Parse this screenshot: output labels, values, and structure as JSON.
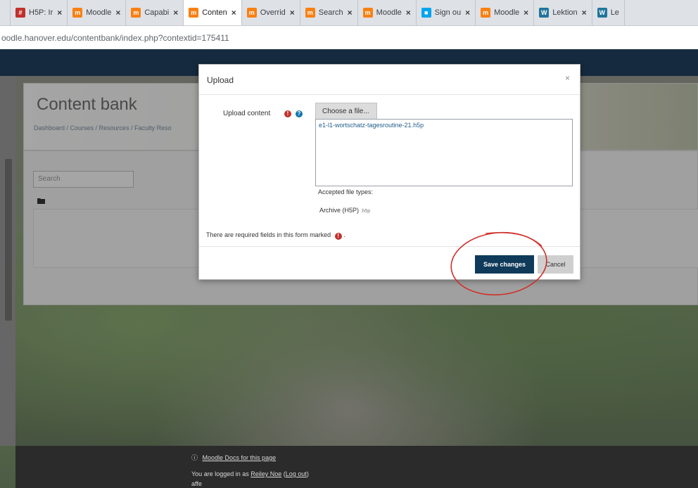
{
  "tabs": [
    {
      "label": "H5P: Ir",
      "icon": "h5p-icon",
      "color": "#c0312b",
      "active": false
    },
    {
      "label": "Moodle",
      "icon": "moodle-icon",
      "color": "#f98012",
      "active": false
    },
    {
      "label": "Capabi",
      "icon": "moodle-m-icon",
      "color": "#f98012",
      "active": false
    },
    {
      "label": "Conten",
      "icon": "moodle-icon",
      "color": "#f98012",
      "active": true
    },
    {
      "label": "Overrid",
      "icon": "moodle-m-icon",
      "color": "#f98012",
      "active": false
    },
    {
      "label": "Search",
      "icon": "moodle-m-icon",
      "color": "#f98012",
      "active": false
    },
    {
      "label": "Moodle",
      "icon": "moodle-m-icon",
      "color": "#f98012",
      "active": false
    },
    {
      "label": "Sign ou",
      "icon": "microsoft-icon",
      "color": "#00a4ef",
      "active": false
    },
    {
      "label": "Moodle",
      "icon": "moodle-m-icon",
      "color": "#f98012",
      "active": false
    },
    {
      "label": "Lektion",
      "icon": "wordpress-icon",
      "color": "#21759b",
      "active": false
    },
    {
      "label": "Le",
      "icon": "wordpress-icon",
      "color": "#21759b",
      "active": false
    }
  ],
  "url": "oodle.hanover.edu/contentbank/index.php?contextid=175411",
  "page": {
    "title": "Content bank",
    "breadcrumb": "Dashboard  /  Courses  /  Resources  /  Faculty Reso",
    "search_placeholder": "Search"
  },
  "modal": {
    "title": "Upload",
    "close": "×",
    "upload_label": "Upload content",
    "choose_button": "Choose a file...",
    "file_name": "e1-l1-wortschatz-tagesroutine-21.h5p",
    "accepted_label": "Accepted file types:",
    "filetype_name": "Archive (H5P)",
    "filetype_ext": ".h5p",
    "required_note": "There are required fields in this form marked",
    "save_label": "Save changes",
    "cancel_label": "Cancel"
  },
  "footer": {
    "docs_link": "Moodle Docs for this page",
    "logged_prefix": "You are logged in as",
    "user_name": "Reiley Noe",
    "logout": "Log out",
    "extra": "affe"
  },
  "colors": {
    "navbar": "#0f2b46",
    "save_button": "#0f3a5a",
    "annotation": "#d0302a"
  }
}
